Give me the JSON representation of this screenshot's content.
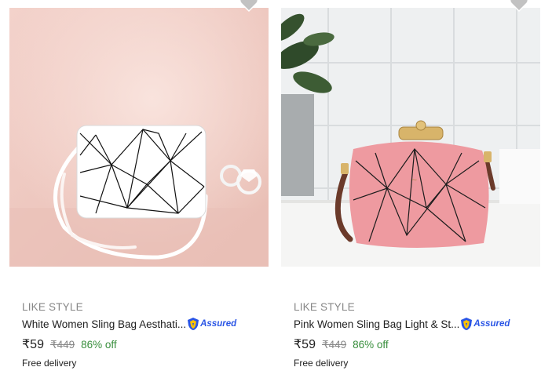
{
  "products": [
    {
      "brand": "LIKE STYLE",
      "title": "White Women Sling Bag Aesthati...",
      "assured_label": "Assured",
      "price": "₹59",
      "mrp": "₹449",
      "discount": "86% off",
      "delivery": "Free delivery",
      "icon": "wishlist-heart-icon"
    },
    {
      "brand": "LIKE STYLE",
      "title": "Pink Women Sling Bag Light & St...",
      "assured_label": "Assured",
      "price": "₹59",
      "mrp": "₹449",
      "discount": "86% off",
      "delivery": "Free delivery",
      "icon": "wishlist-heart-icon"
    }
  ],
  "colors": {
    "discount": "#388e3c",
    "assured": "#2a55e5",
    "muted_text": "#878787"
  }
}
